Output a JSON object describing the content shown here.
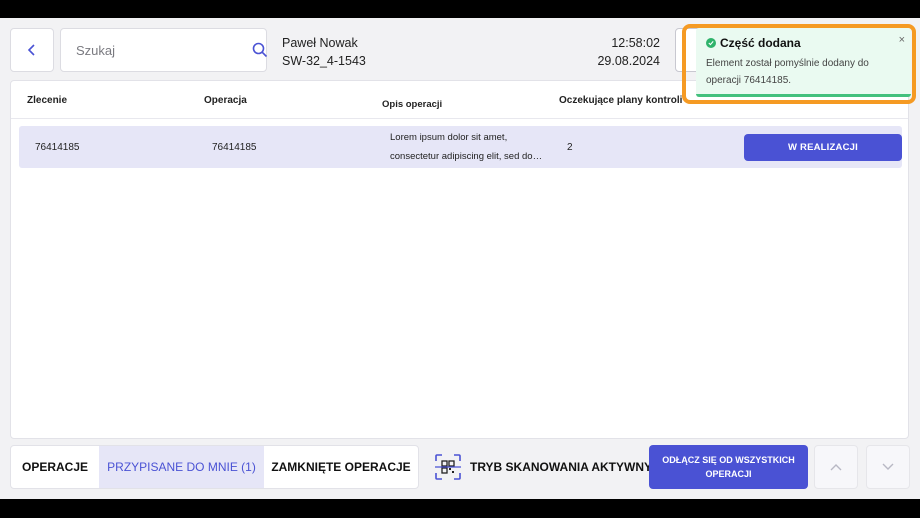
{
  "header": {
    "search_placeholder": "Szukaj",
    "user_name": "Paweł Nowak",
    "workstation": "SW-32_4-1543",
    "time": "12:58:02",
    "date": "29.08.2024"
  },
  "table": {
    "columns": [
      "Zlecenie",
      "Operacja",
      "Opis operacji",
      "Oczekujące plany kontroli"
    ],
    "rows": [
      {
        "order": "76414185",
        "operation": "76414185",
        "description_line1": "Lorem ipsum dolor sit amet,",
        "description_line2": "consectetur adipiscing elit, sed do…",
        "pending_plans": "2",
        "status": "W REALIZACJI"
      }
    ]
  },
  "footer": {
    "tabs": [
      "OPERACJE",
      "PRZYPISANE DO MNIE (1)",
      "ZAMKNIĘTE OPERACJE"
    ],
    "scan_mode": "TRYB SKANOWANIA AKTYWNY",
    "disconnect_all": "ODŁĄCZ SIĘ OD WSZYSTKICH OPERACJI"
  },
  "toast": {
    "title": "Część dodana",
    "message_line1": "Element został pomyślnie dodany do",
    "message_line2": "operacji 76414185.",
    "close": "×"
  },
  "colors": {
    "accent": "#4a52d4",
    "highlight": "#f59a23",
    "success": "#2fb36b"
  }
}
